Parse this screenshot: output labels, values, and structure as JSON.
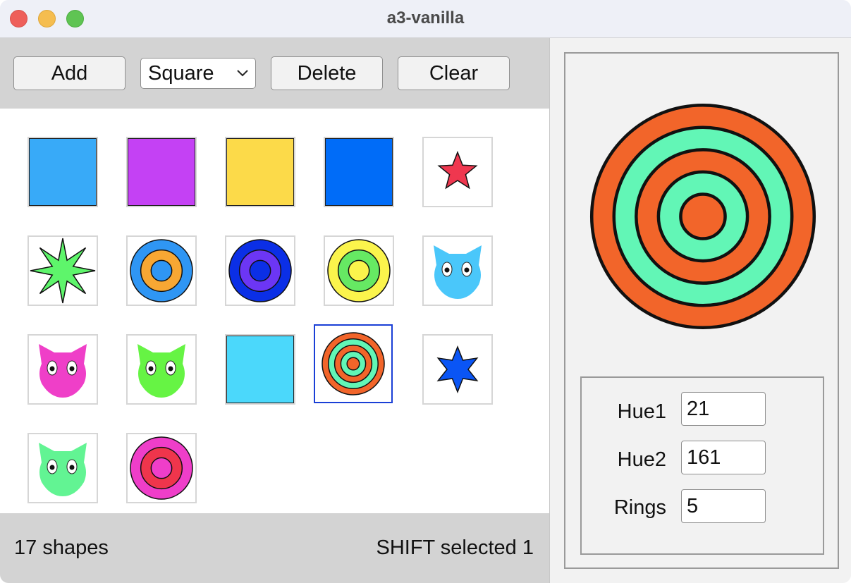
{
  "window": {
    "title": "a3-vanilla"
  },
  "toolbar": {
    "add_label": "Add",
    "shape_select": "Square",
    "delete_label": "Delete",
    "clear_label": "Clear"
  },
  "shapes": [
    {
      "type": "square",
      "color": "#38aaf8"
    },
    {
      "type": "square",
      "color": "#c441f4"
    },
    {
      "type": "square",
      "color": "#fcda49"
    },
    {
      "type": "square",
      "color": "#006cf8"
    },
    {
      "type": "star",
      "color": "#ef374f"
    },
    {
      "type": "star",
      "color": "#5ef56b"
    },
    {
      "type": "target",
      "color1": "#2f96f4",
      "color2": "#f7a733"
    },
    {
      "type": "target",
      "color1": "#0b2fe6",
      "color2": "#6c36f4"
    },
    {
      "type": "target",
      "color1": "#fbf44c",
      "color2": "#66e963"
    },
    {
      "type": "cat",
      "color": "#4ac7fa"
    },
    {
      "type": "cat",
      "color": "#ef3fc8"
    },
    {
      "type": "cat",
      "color": "#66f444"
    },
    {
      "type": "square",
      "color": "#4bd8fb"
    },
    {
      "type": "target",
      "color1": "#f2652a",
      "color2": "#62f6b6",
      "selected": true
    },
    {
      "type": "star",
      "color": "#0a55f5"
    },
    {
      "type": "cat",
      "color": "#62f493"
    },
    {
      "type": "target",
      "color1": "#ef3ec9",
      "color2": "#ef354c"
    }
  ],
  "status": {
    "count": "17 shapes",
    "selection": "SHIFT selected 1"
  },
  "properties": {
    "hue1_label": "Hue1",
    "hue1_value": "21",
    "hue2_label": "Hue2",
    "hue2_value": "161",
    "rings_label": "Rings",
    "rings_value": "5"
  },
  "preview": {
    "color1": "#f2652a",
    "color2": "#62f6b6",
    "rings": 5
  }
}
